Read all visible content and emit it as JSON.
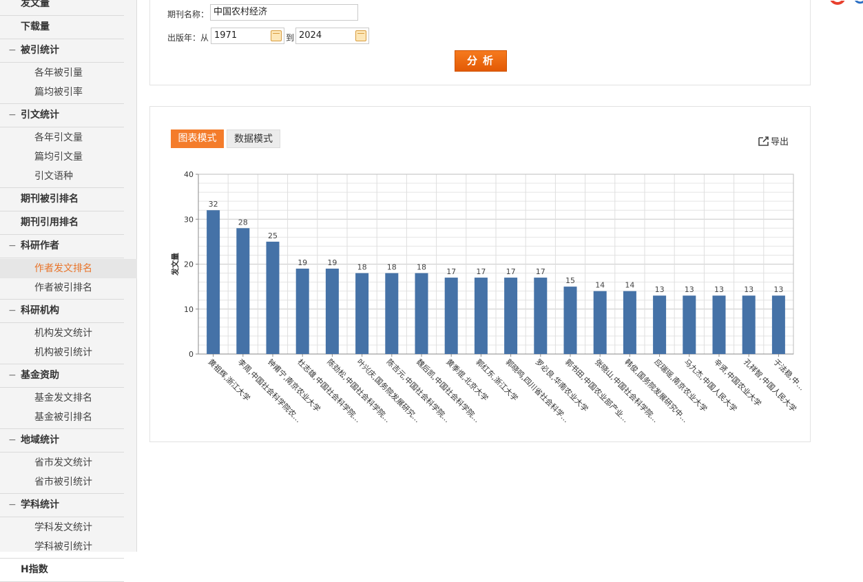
{
  "sidebar": {
    "items": [
      {
        "type": "group",
        "label": "发文量",
        "minus": false
      },
      {
        "type": "group",
        "label": "下载量",
        "minus": false
      },
      {
        "type": "group",
        "label": "被引统计",
        "minus": true
      },
      {
        "type": "sub",
        "label": "各年被引量"
      },
      {
        "type": "sub",
        "label": "篇均被引率"
      },
      {
        "type": "group",
        "label": "引文统计",
        "minus": true
      },
      {
        "type": "sub",
        "label": "各年引文量"
      },
      {
        "type": "sub",
        "label": "篇均引文量"
      },
      {
        "type": "sub",
        "label": "引文语种"
      },
      {
        "type": "group",
        "label": "期刊被引排名",
        "minus": false
      },
      {
        "type": "group",
        "label": "期刊引用排名",
        "minus": false
      },
      {
        "type": "group",
        "label": "科研作者",
        "minus": true
      },
      {
        "type": "sub",
        "label": "作者发文排名",
        "active": true
      },
      {
        "type": "sub",
        "label": "作者被引排名"
      },
      {
        "type": "group",
        "label": "科研机构",
        "minus": true
      },
      {
        "type": "sub",
        "label": "机构发文统计"
      },
      {
        "type": "sub",
        "label": "机构被引统计"
      },
      {
        "type": "group",
        "label": "基金资助",
        "minus": true
      },
      {
        "type": "sub",
        "label": "基金发文排名"
      },
      {
        "type": "sub",
        "label": "基金被引排名"
      },
      {
        "type": "group",
        "label": "地域统计",
        "minus": true
      },
      {
        "type": "sub",
        "label": "省市发文统计"
      },
      {
        "type": "sub",
        "label": "省市被引统计"
      },
      {
        "type": "group",
        "label": "学科统计",
        "minus": true
      },
      {
        "type": "sub",
        "label": "学科发文统计"
      },
      {
        "type": "sub",
        "label": "学科被引统计"
      },
      {
        "type": "group",
        "label": "H指数",
        "minus": false
      }
    ]
  },
  "form": {
    "journal_label": "期刊名称：",
    "journal_value": "中国农村经济",
    "year_label": "出版年：从",
    "year_from": "1971",
    "year_to_label": "到",
    "year_to": "2024",
    "analyze_label": "分析"
  },
  "chart_panel": {
    "tab_chart": "图表模式",
    "tab_data": "数据模式",
    "export_label": "导出"
  },
  "colors": {
    "bar": "#4572a7",
    "accent": "#f47c2b"
  },
  "chart_data": {
    "type": "bar",
    "ylabel": "发文量",
    "ylim": [
      0,
      40
    ],
    "yticks": [
      0,
      10,
      20,
      30,
      40
    ],
    "grid": true,
    "categories": [
      "黄祖辉,浙江大学",
      "李周,中国社会科学院农…",
      "钟甫宁,南京农业大学",
      "杜志雄,中国社会科学院…",
      "陈劲松,中国社会科学院…",
      "叶兴庆,国务院发展研究…",
      "陈吉元,中国社会科学院…",
      "魏后凯,中国社会科学院…",
      "黄季焜,北京大学",
      "郭红东,浙江大学",
      "郭晓鸣,四川省社会科学…",
      "罗必良,华南农业大学",
      "郭书田,中国农业部产业…",
      "张晓山,中国社会科学院…",
      "韩俊,国务院发展研究中…",
      "应瑞瑶,南京农业大学",
      "马九杰,中国人民大学",
      "辛贤,中国农业大学",
      "孔祥智,中国人民大学",
      "于法稳,中…"
    ],
    "values": [
      32,
      28,
      25,
      19,
      19,
      18,
      18,
      18,
      17,
      17,
      17,
      17,
      15,
      14,
      14,
      13,
      13,
      13,
      13,
      13
    ]
  }
}
